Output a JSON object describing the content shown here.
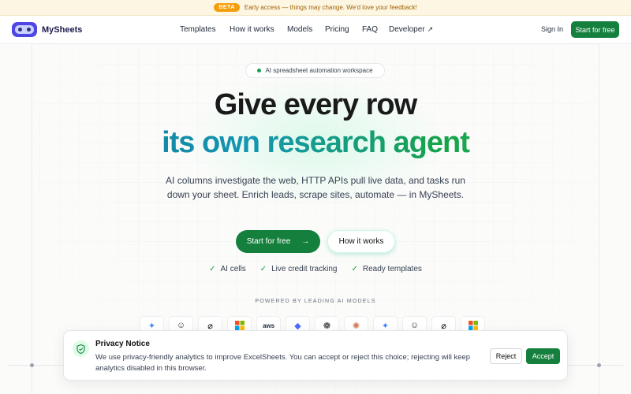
{
  "banner": {
    "badge": "BETA",
    "text": "Early access — things may change. We'd love your feedback!"
  },
  "nav": {
    "logo_text": "MySheets",
    "links": [
      "Templates",
      "How it works",
      "Models",
      "Pricing",
      "FAQ",
      "Developer"
    ],
    "developer_icon": "external-link-icon",
    "signin": "Sign In",
    "cta": "Start for free"
  },
  "hero": {
    "pill": "AI spreadsheet automation workspace",
    "headline_1": "Give every row",
    "headline_2": "its own research agent",
    "subtitle": "AI columns investigate the web, HTTP APIs pull live data, and tasks run down your sheet. Enrich leads, scrape sites, automate — in MySheets.",
    "primary_cta": "Start for free",
    "primary_cta_icon": "arrow-right-icon",
    "secondary_cta": "How it works",
    "checks": [
      "AI cells",
      "Live credit tracking",
      "Ready templates"
    ]
  },
  "models": {
    "heading": "POWERED BY LEADING AI MODELS",
    "icons": [
      "gemini-icon",
      "robot-icon",
      "grok-icon",
      "microsoft-icon",
      "aws-icon",
      "deepseek-icon",
      "openai-icon",
      "claude-icon",
      "gemini-icon",
      "robot-icon",
      "grok-icon",
      "microsoft-icon"
    ],
    "aws_label": "aws"
  },
  "privacy": {
    "title": "Privacy Notice",
    "text": "We use privacy-friendly analytics to improve ExcelSheets. You can accept or reject this choice; rejecting will keep analytics disabled in this browser.",
    "reject": "Reject",
    "accept": "Accept"
  },
  "colors": {
    "brand_green": "#15803d",
    "logo_indigo": "#4f46e5",
    "gradient_teal": "#0e7490",
    "gradient_green": "#22c55e",
    "beta_amber": "#f59e0b"
  }
}
